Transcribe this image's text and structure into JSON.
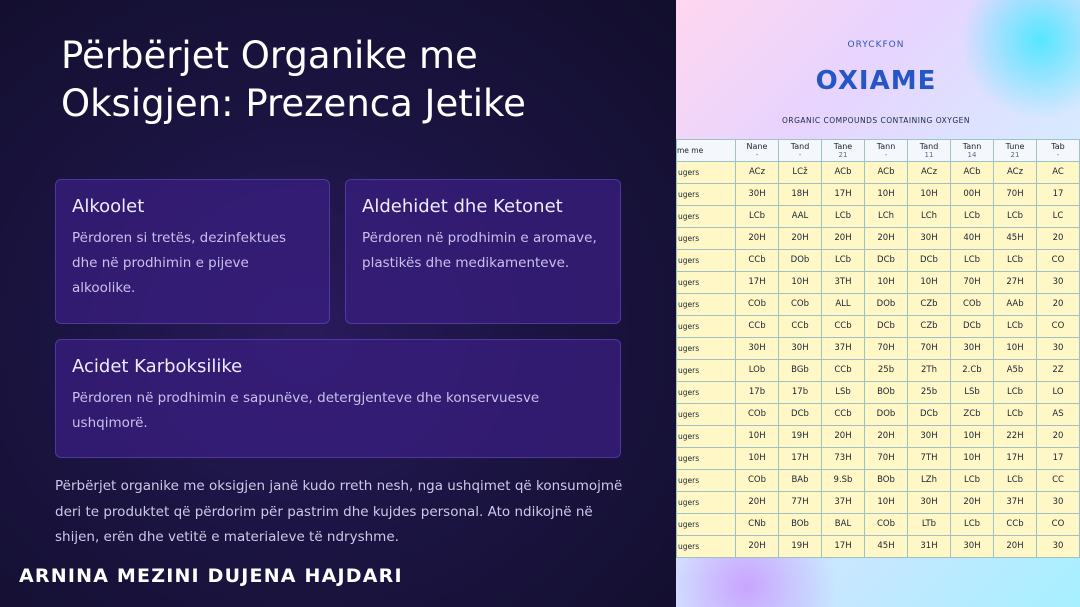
{
  "slide": {
    "title": "Përbërjet Organike me Oksigjen: Prezenca Jetike",
    "cards": [
      {
        "title": "Alkoolet",
        "text": "Përdoren si tretës, dezinfektues dhe në prodhimin e pijeve alkoolike."
      },
      {
        "title": "Aldehidet dhe Ketonet",
        "text": "Përdoren në prodhimin e aromave, plastikës dhe medikamenteve."
      },
      {
        "title": "Acidet Karboksilike",
        "text": "Përdoren në prodhimin e sapunëve, detergjenteve dhe konservuesve ushqimorë."
      }
    ],
    "body": "Përbërjet organike me oksigjen janë kudo rreth nesh, nga ushqimet që konsumojmë deri te produktet që përdorim për pastrim dhe kujdes personal. Ato ndikojnë në shijen, erën dhe vetitë e materialeve të ndryshme.",
    "author": "ARNINA MEZINI DUJENA HAJDARI"
  },
  "poster": {
    "brand": "ORYCKFON",
    "title": "OXIAME",
    "subtitle": "ORGANIC COMPOUNDS CONTAINING OXYGEN",
    "header_label": "me\nme",
    "headers": [
      "Nane",
      "Tand",
      "Tane",
      "Tann",
      "Tand",
      "Tann",
      "Tune",
      "Tab"
    ],
    "header_sub": [
      "-",
      "-",
      "21",
      "-",
      "11",
      "14",
      "21",
      "-"
    ],
    "rows": [
      {
        "label": "ugers",
        "cells": [
          "ACz",
          "LCž",
          "ACb",
          "ACb",
          "ACz",
          "ACb",
          "ACz",
          "AC"
        ]
      },
      {
        "label": "ugers",
        "cells": [
          "30H",
          "18H",
          "17H",
          "10H",
          "10H",
          "00H",
          "70H",
          "17"
        ]
      },
      {
        "label": "ugers",
        "cells": [
          "LCb",
          "AAL",
          "LCb",
          "LCh",
          "LCh",
          "LCb",
          "LCb",
          "LC"
        ]
      },
      {
        "label": "ugers",
        "cells": [
          "20H",
          "20H",
          "20H",
          "20H",
          "30H",
          "40H",
          "45H",
          "20"
        ]
      },
      {
        "label": "ugers",
        "cells": [
          "CCb",
          "DOb",
          "LCb",
          "DCb",
          "DCb",
          "LCb",
          "LCb",
          "CO"
        ]
      },
      {
        "label": "ugers",
        "cells": [
          "17H",
          "10H",
          "3TH",
          "10H",
          "10H",
          "70H",
          "27H",
          "30"
        ]
      },
      {
        "label": "ugers",
        "cells": [
          "COb",
          "COb",
          "ALL",
          "DOb",
          "CZb",
          "COb",
          "AAb",
          "20"
        ]
      },
      {
        "label": "ugers",
        "cells": [
          "CCb",
          "CCb",
          "CCb",
          "DCb",
          "CZb",
          "DCb",
          "LCb",
          "CO"
        ]
      },
      {
        "label": "ugers",
        "cells": [
          "30H",
          "30H",
          "37H",
          "70H",
          "70H",
          "30H",
          "10H",
          "30"
        ]
      },
      {
        "label": "ugers",
        "cells": [
          "LOb",
          "BGb",
          "CCb",
          "25b",
          "2Th",
          "2.Cb",
          "A5b",
          "2Z"
        ]
      },
      {
        "label": "ugers",
        "cells": [
          "17b",
          "17b",
          "LSb",
          "BOb",
          "25b",
          "LSb",
          "LCb",
          "LO"
        ]
      },
      {
        "label": "ugers",
        "cells": [
          "COb",
          "DCb",
          "CCb",
          "DOb",
          "DCb",
          "ZCb",
          "LCb",
          "AS"
        ]
      },
      {
        "label": "ugers",
        "cells": [
          "10H",
          "19H",
          "20H",
          "20H",
          "30H",
          "10H",
          "22H",
          "20"
        ]
      },
      {
        "label": "ugers",
        "cells": [
          "10H",
          "17H",
          "73H",
          "70H",
          "7TH",
          "10H",
          "17H",
          "17"
        ]
      },
      {
        "label": "ugers",
        "cells": [
          "COb",
          "BAb",
          "9.Sb",
          "BOb",
          "LZh",
          "LCb",
          "LCb",
          "CC"
        ]
      },
      {
        "label": "ugers",
        "cells": [
          "20H",
          "77H",
          "37H",
          "10H",
          "30H",
          "20H",
          "37H",
          "30"
        ]
      },
      {
        "label": "ugers",
        "cells": [
          "CNb",
          "BOb",
          "BAL",
          "COb",
          "LTb",
          "LCb",
          "CCb",
          "CO"
        ]
      },
      {
        "label": "ugers",
        "cells": [
          "20H",
          "19H",
          "17H",
          "45H",
          "31H",
          "30H",
          "20H",
          "30"
        ]
      }
    ]
  }
}
